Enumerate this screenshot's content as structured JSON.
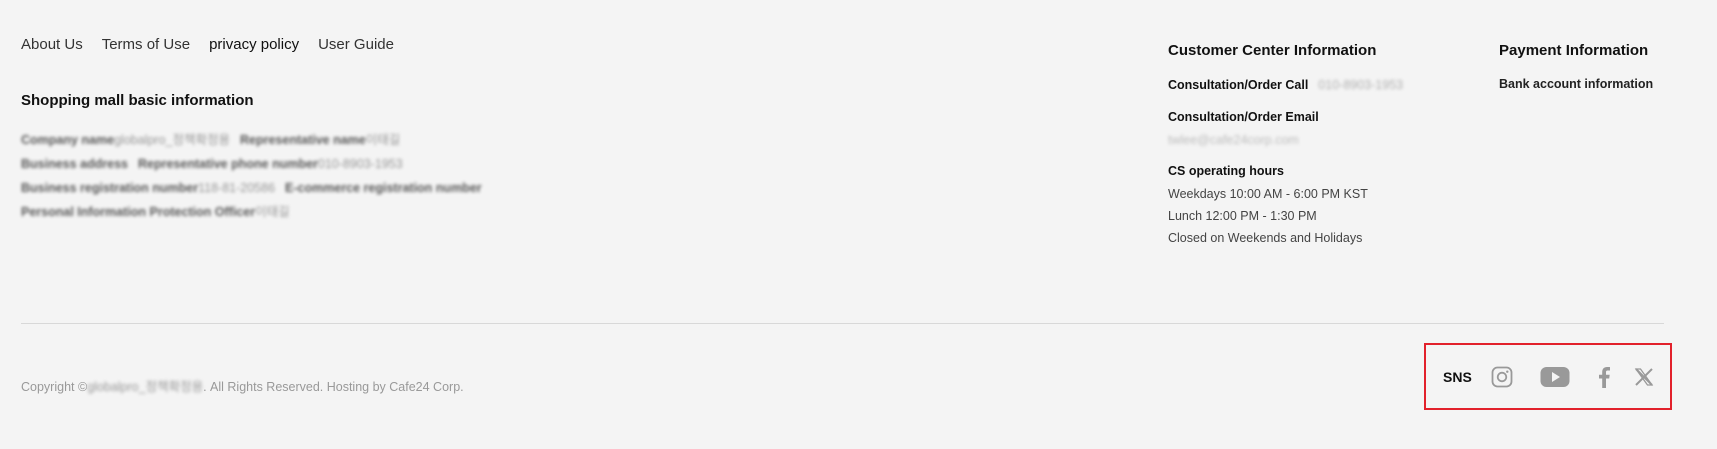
{
  "footer_links": [
    {
      "label": "About Us"
    },
    {
      "label": "Terms of Use"
    },
    {
      "label": "privacy policy"
    },
    {
      "label": "User Guide"
    }
  ],
  "basic_info": {
    "title": "Shopping mall basic information",
    "company_name_label": "Company name",
    "company_name_value": "globalpro_정책확정용",
    "representative_name_label": "Representative name",
    "representative_name_value": "이태길",
    "business_address_label": "Business address",
    "representative_phone_label": "Representative phone number",
    "representative_phone_value": "010-8903-1953",
    "business_reg_label": "Business registration number",
    "business_reg_value": "118-81-20586",
    "ecommerce_reg_label": "E-commerce registration number",
    "privacy_officer_label": "Personal Information Protection Officer",
    "privacy_officer_value": "이태길"
  },
  "customer_center": {
    "title": "Customer Center Information",
    "call_label": "Consultation/Order Call",
    "call_value": "010-8903-1953",
    "email_label": "Consultation/Order Email",
    "email_value": "twlee@cafe24corp.com",
    "hours_title": "CS operating hours",
    "hours_weekdays": "Weekdays 10:00 AM - 6:00 PM KST",
    "hours_lunch": "Lunch 12:00 PM - 1:30 PM",
    "hours_closed": "Closed on Weekends and Holidays"
  },
  "payment": {
    "title": "Payment Information",
    "bank_label": "Bank account information"
  },
  "copyright": {
    "prefix": "Copyright ©",
    "owner": "globalpro_정책확정용",
    "suffix": ". All Rights Reserved. Hosting by Cafe24 Corp."
  },
  "sns": {
    "label": "SNS",
    "icons": [
      "instagram-icon",
      "youtube-icon",
      "facebook-icon",
      "x-icon"
    ]
  },
  "colors": {
    "background": "#f4f4f4",
    "highlight_border": "#e2212b",
    "icon_gray": "#999999"
  }
}
